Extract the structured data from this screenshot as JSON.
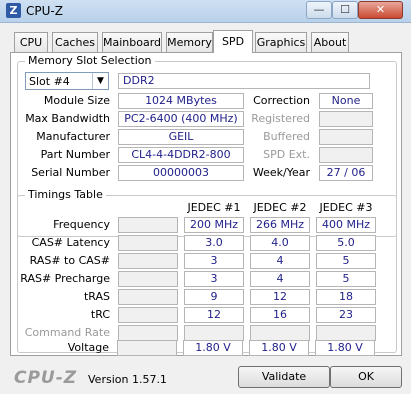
{
  "window": {
    "title": "CPU-Z",
    "app_icon_letter": "Z",
    "minimize_glyph": "—",
    "maximize_glyph": "☐",
    "close_glyph": "✕"
  },
  "tabs": [
    {
      "label": "CPU"
    },
    {
      "label": "Caches"
    },
    {
      "label": "Mainboard"
    },
    {
      "label": "Memory"
    },
    {
      "label": "SPD",
      "active": true
    },
    {
      "label": "Graphics"
    },
    {
      "label": "About"
    }
  ],
  "memory_slot": {
    "title": "Memory Slot Selection",
    "slot_selected": "Slot #4",
    "dropdown_glyph": "▼",
    "type": "DDR2",
    "module_size_label": "Module Size",
    "module_size": "1024 MBytes",
    "max_bandwidth_label": "Max Bandwidth",
    "max_bandwidth": "PC2-6400 (400 MHz)",
    "manufacturer_label": "Manufacturer",
    "manufacturer": "GEIL",
    "part_number_label": "Part Number",
    "part_number": "CL4-4-4DDR2-800",
    "serial_number_label": "Serial Number",
    "serial_number": "00000003",
    "correction_label": "Correction",
    "correction": "None",
    "registered_label": "Registered",
    "registered": "",
    "buffered_label": "Buffered",
    "buffered": "",
    "spd_ext_label": "SPD Ext.",
    "spd_ext": "",
    "week_year_label": "Week/Year",
    "week_year": "27 / 06"
  },
  "timings": {
    "title": "Timings Table",
    "columns": [
      "JEDEC #1",
      "JEDEC #2",
      "JEDEC #3"
    ],
    "rows": [
      {
        "label": "Frequency",
        "extra": "",
        "values": [
          "200 MHz",
          "266 MHz",
          "400 MHz"
        ]
      },
      {
        "label": "CAS# Latency",
        "extra": "",
        "values": [
          "3.0",
          "4.0",
          "5.0"
        ]
      },
      {
        "label": "RAS# to CAS#",
        "extra": "",
        "values": [
          "3",
          "4",
          "5"
        ]
      },
      {
        "label": "RAS# Precharge",
        "extra": "",
        "values": [
          "3",
          "4",
          "5"
        ]
      },
      {
        "label": "tRAS",
        "extra": "",
        "values": [
          "9",
          "12",
          "18"
        ]
      },
      {
        "label": "tRC",
        "extra": "",
        "values": [
          "12",
          "16",
          "23"
        ]
      },
      {
        "label": "Command Rate",
        "extra": "",
        "values": [
          "",
          "",
          ""
        ],
        "dim": true
      },
      {
        "label": "Voltage",
        "extra": "",
        "values": [
          "1.80 V",
          "1.80 V",
          "1.80 V"
        ]
      }
    ]
  },
  "footer": {
    "logo": "CPU-Z",
    "version": "Version 1.57.1",
    "validate_label": "Validate",
    "ok_label": "OK"
  }
}
